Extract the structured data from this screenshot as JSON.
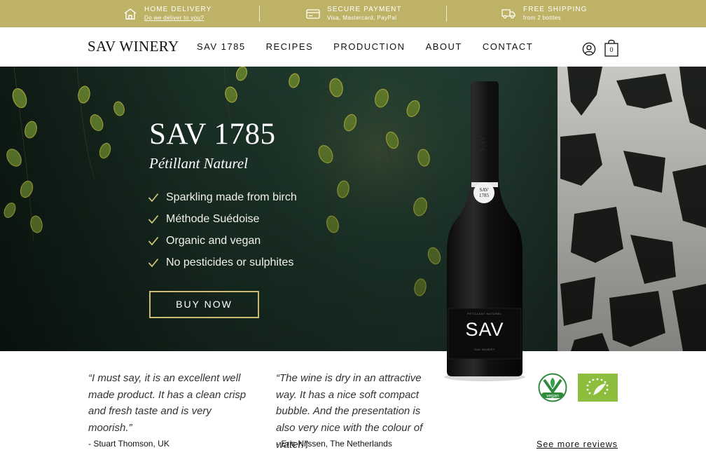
{
  "topbar": {
    "delivery": {
      "title": "HOME DELIVERY",
      "sub": "Do we deliver to you?",
      "icon": "house-icon"
    },
    "payment": {
      "title": "SECURE PAYMENT",
      "sub": "Visa, Mastercard, PayPal",
      "icon": "credit-card-icon"
    },
    "shipping": {
      "title": "FREE SHIPPING",
      "sub": "from 2 bottles",
      "icon": "truck-icon"
    }
  },
  "nav": {
    "logo": "SAV WINERY",
    "items": [
      "SAV 1785",
      "RECIPES",
      "PRODUCTION",
      "ABOUT",
      "CONTACT"
    ],
    "cart_count": "0",
    "icons": [
      "user-icon",
      "shopping-bag-icon"
    ]
  },
  "hero": {
    "title": "SAV 1785",
    "subtitle": "Pétillant Naturel",
    "features": [
      "Sparkling made from birch",
      "Méthode Suédoise",
      "Organic and vegan",
      "No pesticides or sulphites"
    ],
    "button": "BUY NOW",
    "bottle": {
      "neck_text": "SAV",
      "badge_line1": "SAV",
      "badge_line2": "1785",
      "label_top": "PÉTILLANT NATUREL",
      "brand": "SAV",
      "label_bottom": "SAV WINERY"
    }
  },
  "reviews": [
    {
      "quote": "“I must say, it is an excellent well made product. It has a clean crisp and fresh taste and is very moorish.”",
      "author": "- Stuart Thomson, UK"
    },
    {
      "quote": "“The wine is dry in an attractive way. It has a nice soft compact bubble. And the presentation is also very nice with the colour of water.”",
      "author": "- Eric Nijssen, The Netherlands"
    }
  ],
  "badges": {
    "vegan": "vegan",
    "eu_organic": "EU organic leaf"
  },
  "see_more": "See more reviews",
  "colors": {
    "accent": "#bdb265",
    "button_border": "#c9bb72",
    "organic_green": "#8dbd3c"
  }
}
